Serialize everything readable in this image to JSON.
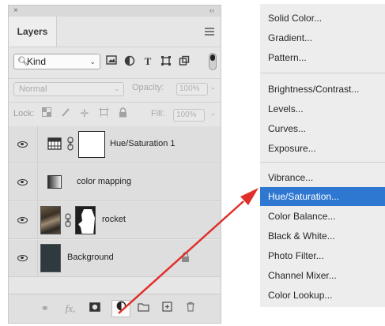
{
  "panel": {
    "close_glyph": "×",
    "collapse_glyph": "‹‹",
    "tab_label": "Layers",
    "filter": {
      "kind_label": "Kind",
      "icons": [
        "image-filter-icon",
        "adjustment-filter-icon",
        "type-filter-icon",
        "shape-filter-icon",
        "smart-object-filter-icon"
      ]
    },
    "blend_mode": "Normal",
    "opacity_label": "Opacity:",
    "opacity_value": "100%",
    "lock_label": "Lock:",
    "fill_label": "Fill:",
    "fill_value": "100%",
    "layers": [
      {
        "name": "Hue/Saturation 1",
        "kind": "adjustment",
        "visible": true
      },
      {
        "name": "color mapping",
        "kind": "gradient-map",
        "visible": true
      },
      {
        "name": "rocket",
        "kind": "image-with-mask",
        "visible": true
      },
      {
        "name": "Background",
        "kind": "background",
        "visible": true,
        "locked": true
      }
    ],
    "bottom_icons": [
      "link-layers-icon",
      "fx-icon",
      "add-mask-icon",
      "new-adjustment-layer-icon",
      "new-group-icon",
      "new-layer-icon",
      "delete-layer-icon"
    ]
  },
  "menu": {
    "groups": [
      [
        "Solid Color...",
        "Gradient...",
        "Pattern..."
      ],
      [
        "Brightness/Contrast...",
        "Levels...",
        "Curves...",
        "Exposure..."
      ],
      [
        "Vibrance...",
        "Hue/Saturation...",
        "Color Balance...",
        "Black & White...",
        "Photo Filter...",
        "Channel Mixer...",
        "Color Lookup..."
      ]
    ],
    "selected": "Hue/Saturation...",
    "selected_color": "#2f78d2"
  },
  "annotation": {
    "arrow_color": "#e0302b"
  }
}
